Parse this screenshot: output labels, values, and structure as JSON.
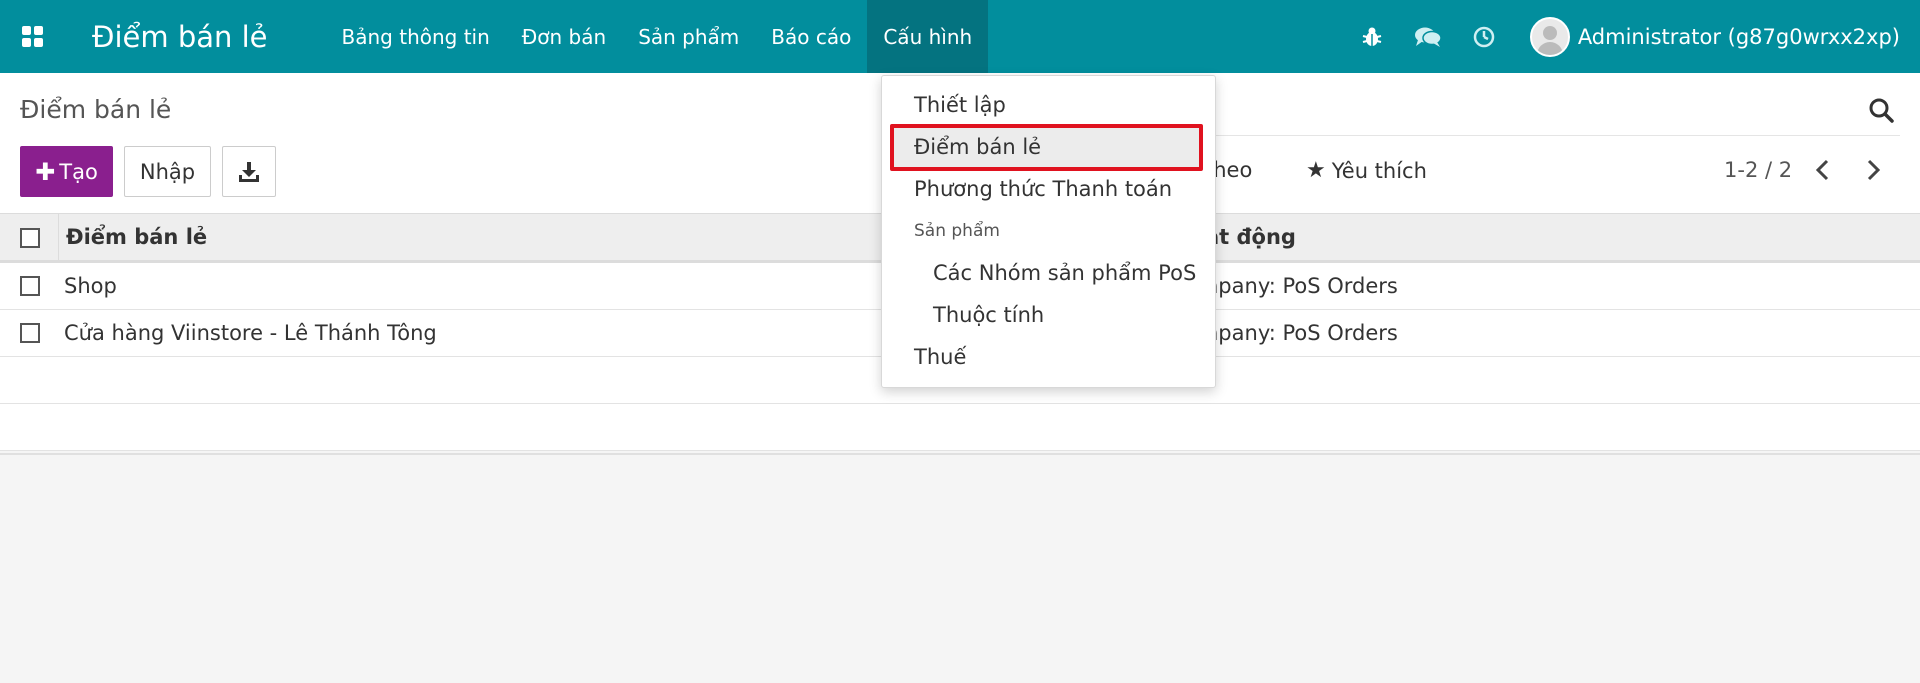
{
  "navbar": {
    "app_title": "Điểm bán lẻ",
    "menu": [
      "Bảng thông tin",
      "Đơn bán",
      "Sản phẩm",
      "Báo cáo",
      "Cấu hình"
    ],
    "active_menu": "Cấu hình",
    "user_name": "Administrator (g87g0wrxx2xp)",
    "icons": [
      "apps-grid-icon",
      "bug-icon",
      "chat-icon",
      "clock-icon"
    ]
  },
  "control_panel": {
    "breadcrumb": "Điểm bán lẻ",
    "create_label": "Tạo",
    "import_label": "Nhập",
    "group_by_partial": "n theo",
    "favorites_label": "Yêu thích",
    "pager": "1-2 / 2"
  },
  "list": {
    "headers": [
      "Điểm bán lẻ",
      "ạt động"
    ],
    "rows": [
      {
        "name": "Shop",
        "company": "npany: PoS Orders"
      },
      {
        "name": "Cửa hàng Viinstore - Lê Thánh Tông",
        "company": "npany: PoS Orders"
      }
    ]
  },
  "dropdown": {
    "items": {
      "settings": "Thiết lập",
      "pos": "Điểm bán lẻ",
      "payment_methods": "Phương thức Thanh toán",
      "products_header": "Sản phẩm",
      "pos_categories": "Các Nhóm sản phẩm PoS",
      "attributes": "Thuộc tính",
      "taxes": "Thuế"
    },
    "highlighted": "Điểm bán lẻ"
  },
  "colors": {
    "navbar": "#028e9d",
    "active_menu": "#047380",
    "create_button": "#8a1f8e",
    "highlight_border": "#e0121f"
  }
}
